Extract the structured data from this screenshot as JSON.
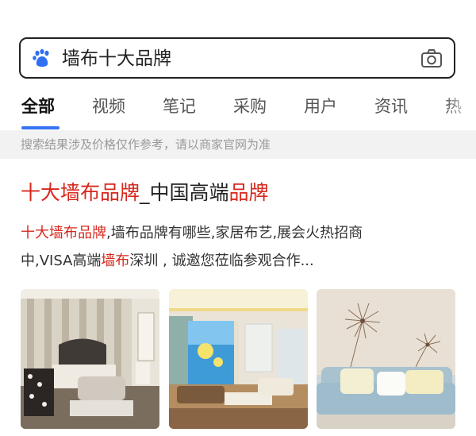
{
  "search": {
    "query": "墙布十大品牌",
    "logo_icon": "baidu-paw-icon",
    "camera_icon": "camera-icon"
  },
  "tabs": [
    {
      "label": "全部",
      "active": true
    },
    {
      "label": "视频"
    },
    {
      "label": "笔记"
    },
    {
      "label": "采购"
    },
    {
      "label": "用户"
    },
    {
      "label": "资讯"
    },
    {
      "label": "热"
    }
  ],
  "disclaimer": "搜索结果涉及价格仅作参考，请以商家官网为准",
  "result": {
    "title_parts": [
      "十大墙布品牌",
      "_中国高端",
      "品牌"
    ],
    "snippet_line1_parts": [
      "十大墙布品牌",
      ",墙布品牌有哪些,家居布艺,展会火热招商"
    ],
    "snippet_line2_parts": [
      "中,VISA高端",
      "墙布",
      "深圳 , 诚邀您莅临参观合作..."
    ]
  },
  "colors": {
    "accent": "#3673f5",
    "highlight": "#d8271c",
    "text": "#222222",
    "muted": "#9a9a9a"
  }
}
